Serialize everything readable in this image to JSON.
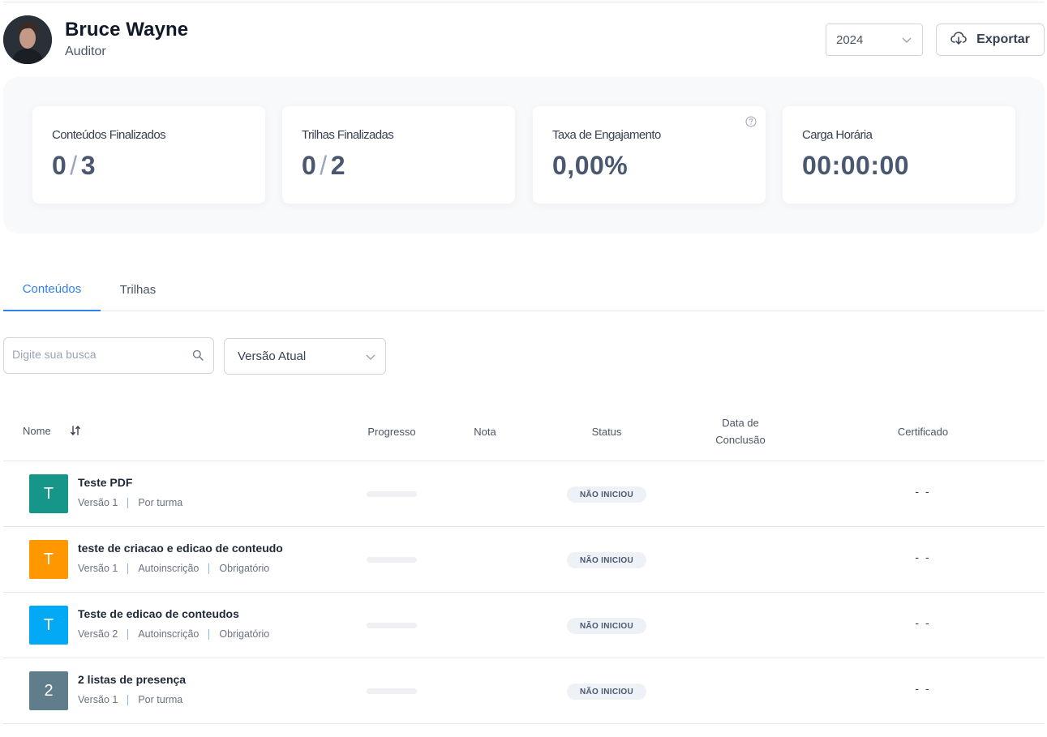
{
  "colors": {
    "accent": "#2f80ed",
    "teal": "#159688",
    "orange": "#ff9800",
    "blue": "#03a9f4",
    "slate": "#607d8b"
  },
  "header": {
    "user_name": "Bruce Wayne",
    "user_role": "Auditor",
    "year": "2024",
    "export_label": "Exportar"
  },
  "stats": [
    {
      "label": "Conteúdos Finalizados",
      "done": "0",
      "total": "3"
    },
    {
      "label": "Trilhas Finalizadas",
      "done": "0",
      "total": "2"
    },
    {
      "label": "Taxa de Engajamento",
      "value": "0,00%"
    },
    {
      "label": "Carga Horária",
      "value": "00:00:00"
    }
  ],
  "tabs": [
    {
      "label": "Conteúdos",
      "active": true
    },
    {
      "label": "Trilhas",
      "active": false
    }
  ],
  "filters": {
    "search_placeholder": "Digite sua busca",
    "version": "Versão Atual"
  },
  "table": {
    "columns": {
      "name": "Nome",
      "progress": "Progresso",
      "grade": "Nota",
      "status": "Status",
      "completion_line1": "Data de",
      "completion_line2": "Conclusão",
      "certificate": "Certificado"
    },
    "rows": [
      {
        "initial": "T",
        "color": "#159688",
        "title": "Teste PDF",
        "meta": [
          "Versão 1",
          "Por turma"
        ],
        "progress": 0,
        "grade": "",
        "status": "NÃO INICIOU",
        "completion": "",
        "certificate": "- -"
      },
      {
        "initial": "T",
        "color": "#ff9800",
        "title": "teste de criacao e edicao de conteudo",
        "meta": [
          "Versão 1",
          "Autoinscrição",
          "Obrigatório"
        ],
        "progress": 0,
        "grade": "",
        "status": "NÃO INICIOU",
        "completion": "",
        "certificate": "- -"
      },
      {
        "initial": "T",
        "color": "#03a9f4",
        "title": "Teste de edicao de conteudos",
        "meta": [
          "Versão 2",
          "Autoinscrição",
          "Obrigatório"
        ],
        "progress": 0,
        "grade": "",
        "status": "NÃO INICIOU",
        "completion": "",
        "certificate": "- -"
      },
      {
        "initial": "2",
        "color": "#607d8b",
        "title": "2 listas de presença",
        "meta": [
          "Versão 1",
          "Por turma"
        ],
        "progress": 0,
        "grade": "",
        "status": "NÃO INICIOU",
        "completion": "",
        "certificate": "- -"
      }
    ]
  }
}
